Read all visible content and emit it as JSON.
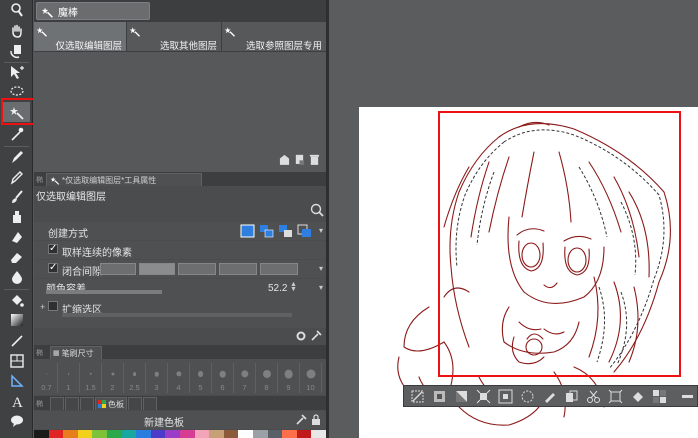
{
  "subtool_panel": {
    "tab_label": "魔棒",
    "tools": [
      {
        "label": "仅选取编辑图层",
        "active": true
      },
      {
        "label": "选取其他图层",
        "active": false
      },
      {
        "label": "选取参照图层专用",
        "active": false
      }
    ]
  },
  "tool_property": {
    "tab_label": "*仅选取编辑图层*工具属性",
    "title": "仅选取编辑图层",
    "create_mode_label": "创建方式",
    "contiguous_label": "取样连续的像素",
    "close_gap_label": "闭合间隙",
    "color_tolerance_label": "颜色容差",
    "color_tolerance_value": "52.2",
    "expand_label": "扩缩选区"
  },
  "brush_size": {
    "tab_label": "笔刷尺寸",
    "sizes": [
      "0.7",
      "1",
      "1.5",
      "2",
      "2.5",
      "3",
      "4",
      "5",
      "6",
      "7",
      "8",
      "9",
      "10"
    ]
  },
  "color_palette": {
    "tab_label": "色板",
    "new_palette_label": "新建色板",
    "swatches": [
      "#1a1a1a",
      "#e02424",
      "#e87d1e",
      "#f2d11b",
      "#7ec23a",
      "#2aa84a",
      "#19a8a0",
      "#2a7de0",
      "#4a3cc8",
      "#9b3cc8",
      "#d63c94",
      "#f3a4b8",
      "#c8a078",
      "#8a5a3a",
      "#ffffff",
      "#9aa0a6",
      "#5a6068",
      "#ff6e4a",
      "#c01a1a",
      "#e8e8e8"
    ]
  },
  "colors": {
    "highlight_red": "#ee1111",
    "line_art": "#8b1a1a"
  }
}
